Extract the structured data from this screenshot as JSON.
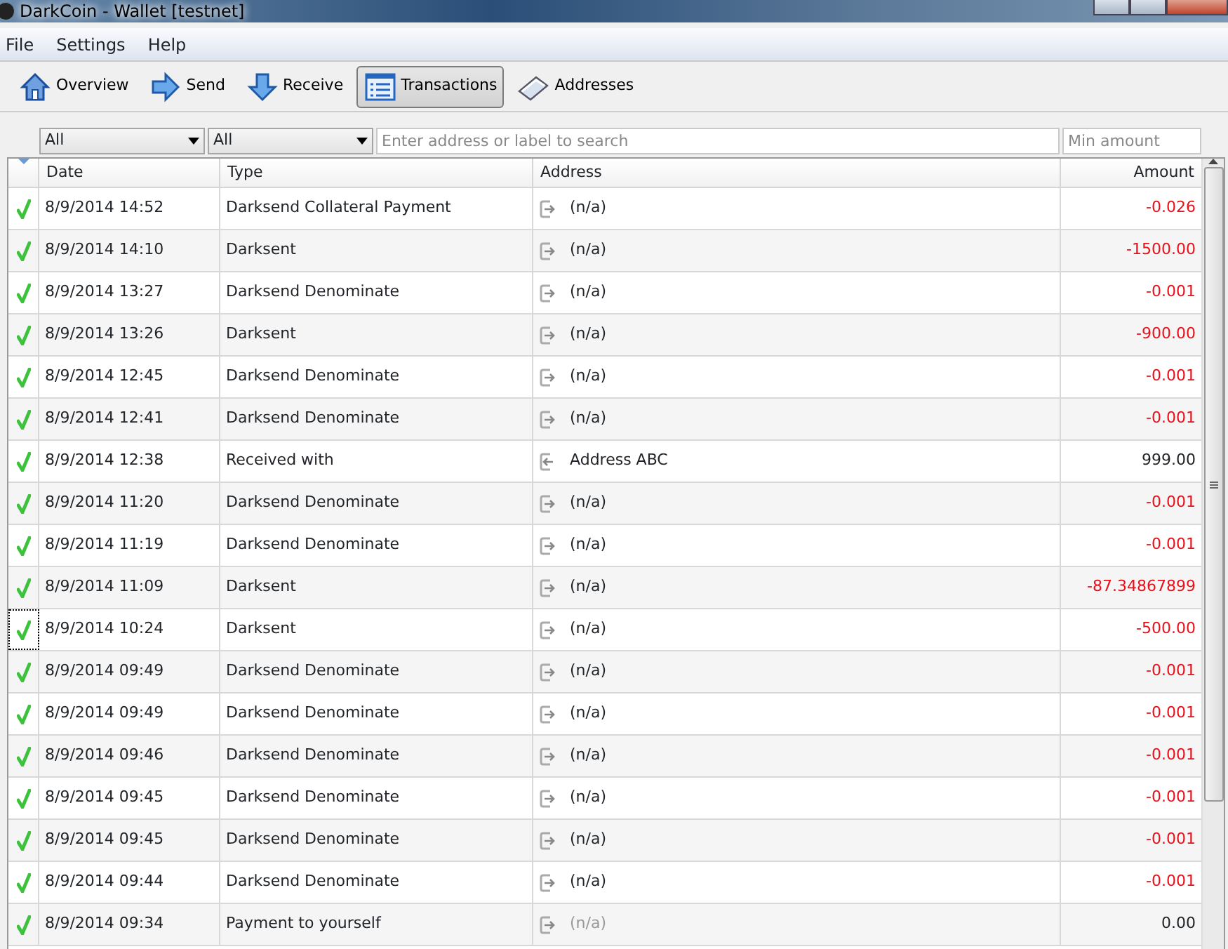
{
  "window": {
    "title": "DarkCoin - Wallet [testnet]"
  },
  "menu": [
    "File",
    "Settings",
    "Help"
  ],
  "toolbar": [
    {
      "label": "Overview",
      "kind": "home",
      "selected": false
    },
    {
      "label": "Send",
      "kind": "send",
      "selected": false
    },
    {
      "label": "Receive",
      "kind": "receive",
      "selected": false
    },
    {
      "label": "Transactions",
      "kind": "list",
      "selected": true
    },
    {
      "label": "Addresses",
      "kind": "book",
      "selected": false
    }
  ],
  "filters": {
    "date": "All",
    "type": "All",
    "search": {
      "placeholder": "Enter address or label to search"
    },
    "min_amount": {
      "placeholder": "Min amount"
    }
  },
  "table": {
    "columns": [
      "Date",
      "Type",
      "Address",
      "Amount"
    ],
    "rows": [
      {
        "date": "8/9/2014 14:52",
        "type": "Darksend Collateral Payment",
        "address": "(n/a)",
        "amount": "-0.026",
        "negative": true,
        "kind": "out",
        "address_dimmed": false,
        "focused": false
      },
      {
        "date": "8/9/2014 14:10",
        "type": "Darksent",
        "address": "(n/a)",
        "amount": "-1500.00",
        "negative": true,
        "kind": "out",
        "address_dimmed": false,
        "focused": false
      },
      {
        "date": "8/9/2014 13:27",
        "type": "Darksend Denominate",
        "address": "(n/a)",
        "amount": "-0.001",
        "negative": true,
        "kind": "out",
        "address_dimmed": false,
        "focused": false
      },
      {
        "date": "8/9/2014 13:26",
        "type": "Darksent",
        "address": "(n/a)",
        "amount": "-900.00",
        "negative": true,
        "kind": "out",
        "address_dimmed": false,
        "focused": false
      },
      {
        "date": "8/9/2014 12:45",
        "type": "Darksend Denominate",
        "address": "(n/a)",
        "amount": "-0.001",
        "negative": true,
        "kind": "out",
        "address_dimmed": false,
        "focused": false
      },
      {
        "date": "8/9/2014 12:41",
        "type": "Darksend Denominate",
        "address": "(n/a)",
        "amount": "-0.001",
        "negative": true,
        "kind": "out",
        "address_dimmed": false,
        "focused": false
      },
      {
        "date": "8/9/2014 12:38",
        "type": "Received with",
        "address": "Address ABC",
        "amount": "999.00",
        "negative": false,
        "kind": "in",
        "address_dimmed": false,
        "focused": false
      },
      {
        "date": "8/9/2014 11:20",
        "type": "Darksend Denominate",
        "address": "(n/a)",
        "amount": "-0.001",
        "negative": true,
        "kind": "out",
        "address_dimmed": false,
        "focused": false
      },
      {
        "date": "8/9/2014 11:19",
        "type": "Darksend Denominate",
        "address": "(n/a)",
        "amount": "-0.001",
        "negative": true,
        "kind": "out",
        "address_dimmed": false,
        "focused": false
      },
      {
        "date": "8/9/2014 11:09",
        "type": "Darksent",
        "address": "(n/a)",
        "amount": "-87.34867899",
        "negative": true,
        "kind": "out",
        "address_dimmed": false,
        "focused": false
      },
      {
        "date": "8/9/2014 10:24",
        "type": "Darksent",
        "address": "(n/a)",
        "amount": "-500.00",
        "negative": true,
        "kind": "out",
        "address_dimmed": false,
        "focused": true
      },
      {
        "date": "8/9/2014 09:49",
        "type": "Darksend Denominate",
        "address": "(n/a)",
        "amount": "-0.001",
        "negative": true,
        "kind": "out",
        "address_dimmed": false,
        "focused": false
      },
      {
        "date": "8/9/2014 09:49",
        "type": "Darksend Denominate",
        "address": "(n/a)",
        "amount": "-0.001",
        "negative": true,
        "kind": "out",
        "address_dimmed": false,
        "focused": false
      },
      {
        "date": "8/9/2014 09:46",
        "type": "Darksend Denominate",
        "address": "(n/a)",
        "amount": "-0.001",
        "negative": true,
        "kind": "out",
        "address_dimmed": false,
        "focused": false
      },
      {
        "date": "8/9/2014 09:45",
        "type": "Darksend Denominate",
        "address": "(n/a)",
        "amount": "-0.001",
        "negative": true,
        "kind": "out",
        "address_dimmed": false,
        "focused": false
      },
      {
        "date": "8/9/2014 09:45",
        "type": "Darksend Denominate",
        "address": "(n/a)",
        "amount": "-0.001",
        "negative": true,
        "kind": "out",
        "address_dimmed": false,
        "focused": false
      },
      {
        "date": "8/9/2014 09:44",
        "type": "Darksend Denominate",
        "address": "(n/a)",
        "amount": "-0.001",
        "negative": true,
        "kind": "out",
        "address_dimmed": false,
        "focused": false
      },
      {
        "date": "8/9/2014 09:34",
        "type": "Payment to yourself",
        "address": "(n/a)",
        "amount": "0.00",
        "negative": false,
        "kind": "out",
        "address_dimmed": true,
        "focused": false
      }
    ]
  }
}
